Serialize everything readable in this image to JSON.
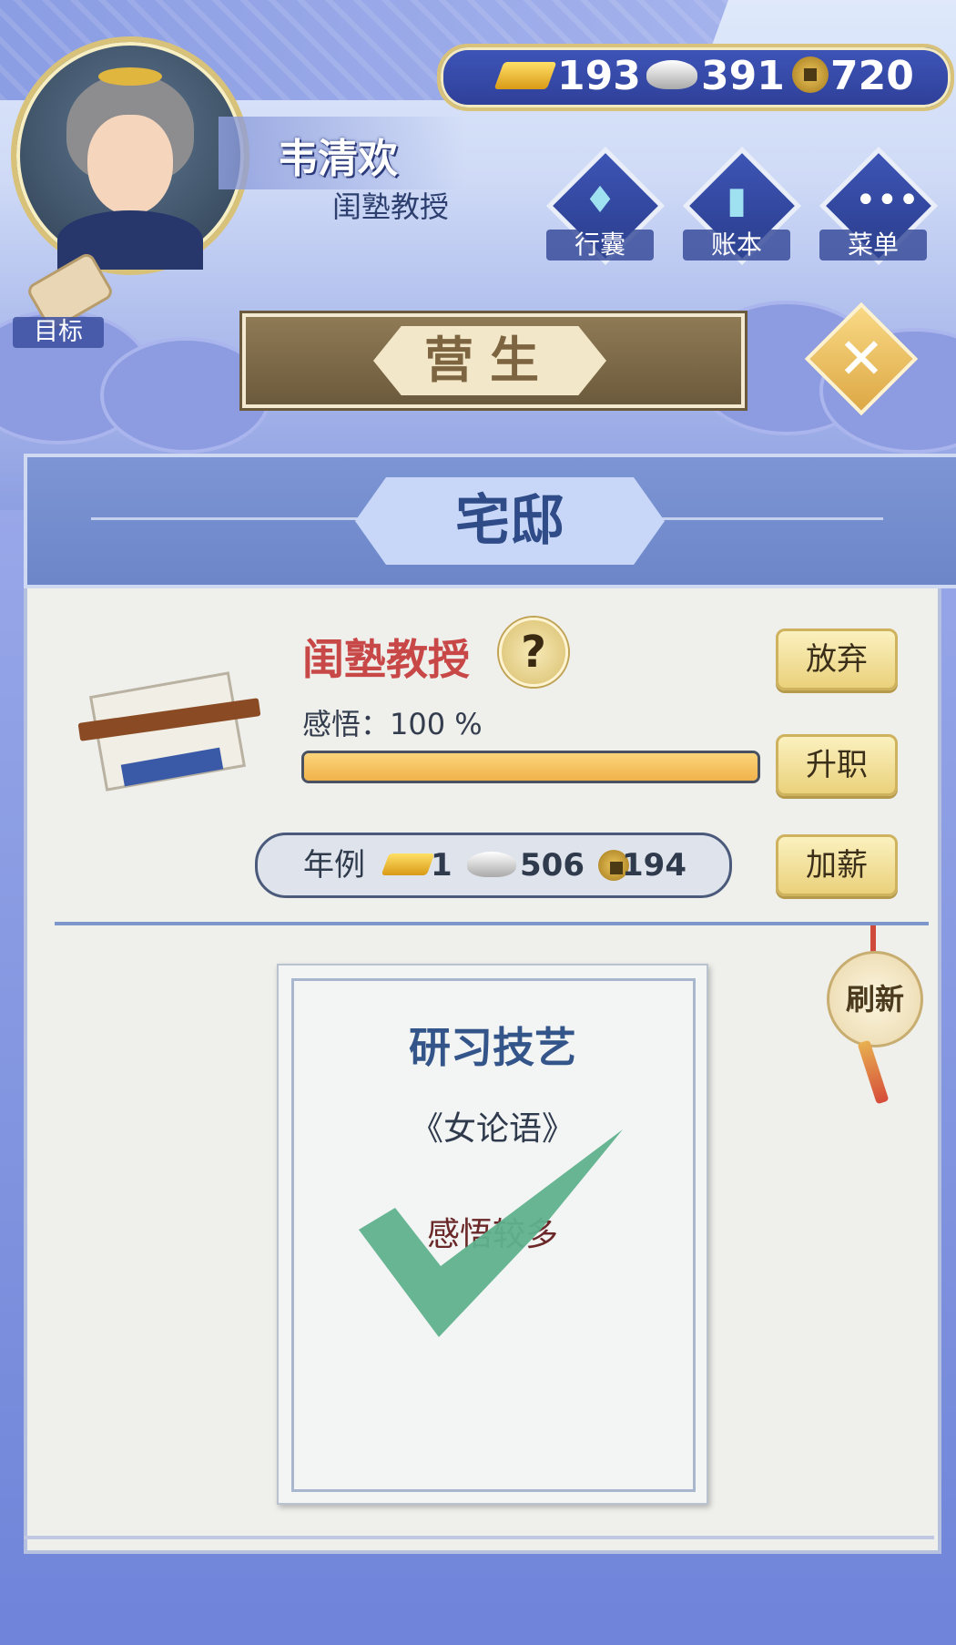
{
  "player": {
    "name": "韦清欢",
    "title": "闺塾教授"
  },
  "currency": {
    "gold": "193",
    "silver": "391",
    "copper": "720"
  },
  "top_buttons": {
    "bag": "行囊",
    "ledger": "账本",
    "menu": "菜单"
  },
  "goal_label": "目标",
  "section_title": "营生",
  "panel_title": "宅邸",
  "job": {
    "name": "闺塾教授",
    "help": "?",
    "insight_label": "感悟：100 %",
    "insight_percent": 100,
    "buttons": {
      "quit": "放弃",
      "promote": "升职",
      "raise": "加薪"
    },
    "salary": {
      "label": "年例",
      "gold": "1",
      "silver": "506",
      "copper": "194"
    }
  },
  "card": {
    "title": "研习技艺",
    "book": "《女论语》",
    "effect": "感悟较多"
  },
  "refresh_label": "刷新",
  "colors": {
    "check": "#5fb18d",
    "job_name": "#c84848",
    "progress_fill": "#f4bd5c"
  }
}
